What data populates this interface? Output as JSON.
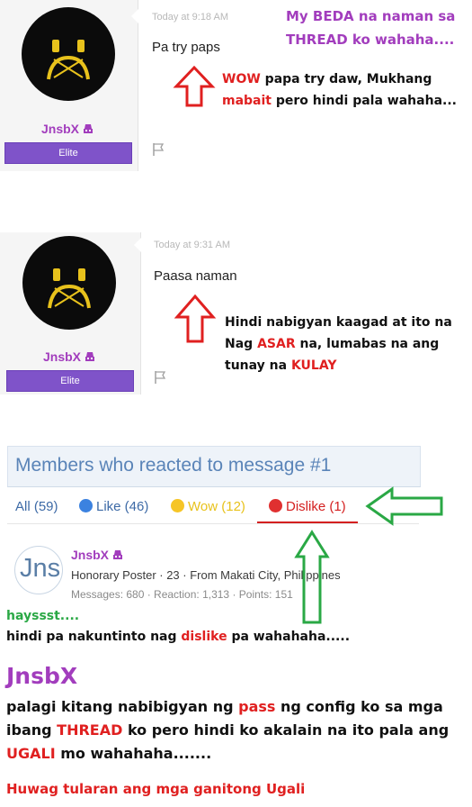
{
  "post1": {
    "timestamp": "Today at 9:18 AM",
    "message": "Pa try paps",
    "username": "JnsbX",
    "badge": "Elite",
    "annotation_top": [
      "My BEDA na naman sa",
      "THREAD ko wahaha...."
    ],
    "annotation_line1_a": "WOW",
    "annotation_line1_b": " papa try daw, Mukhang",
    "annotation_line2_a": "mabait",
    "annotation_line2_b": " pero hindi pala wahaha..."
  },
  "post2": {
    "timestamp": "Today at 9:31 AM",
    "message": "Paasa naman",
    "username": "JnsbX",
    "badge": "Elite",
    "annotation_line1": "Hindi nabigyan kaagad at ito na",
    "annotation_line2_a": "Nag ",
    "annotation_line2_b": "ASAR",
    "annotation_line2_c": " na, lumabas na ang",
    "annotation_line3_a": "tunay na ",
    "annotation_line3_b": "KULAY"
  },
  "reactions": {
    "title": "Members who reacted to message #1",
    "tabs": {
      "all": "All (59)",
      "like": "Like (46)",
      "wow": "Wow (12)",
      "dislike": "Dislike (1)"
    },
    "member": {
      "avatar_text": "Jns",
      "name": "JnsbX",
      "info": "Honorary Poster · 23 · From Makati City, Philippines",
      "stats": "Messages: 680 · Reaction: 1,313 · Points: 151"
    }
  },
  "bottom": {
    "green_line": "hayssst....",
    "line2_a": "hindi pa nakuntinto nag ",
    "line2_b": "dislike",
    "line2_c": " pa wahahaha.....",
    "big_name": "JnsbX",
    "para_1a": "palagi kitang nabibigyan ng ",
    "para_1b": "pass",
    "para_1c": " ng config ko sa mga",
    "para_2a": "ibang ",
    "para_2b": "THREAD",
    "para_2c": " ko pero hindi ko akalain na ito pala ang",
    "para_3a": "UGALI",
    "para_3b": " mo wahahaha.......",
    "final_line": "Huwag tularan ang mga ganitong Ugali"
  },
  "colors": {
    "purple": "#a23dbd",
    "red": "#e02020",
    "green": "#2aa845",
    "link_blue": "#3d6aa6",
    "tab_underline": "#d42020"
  }
}
